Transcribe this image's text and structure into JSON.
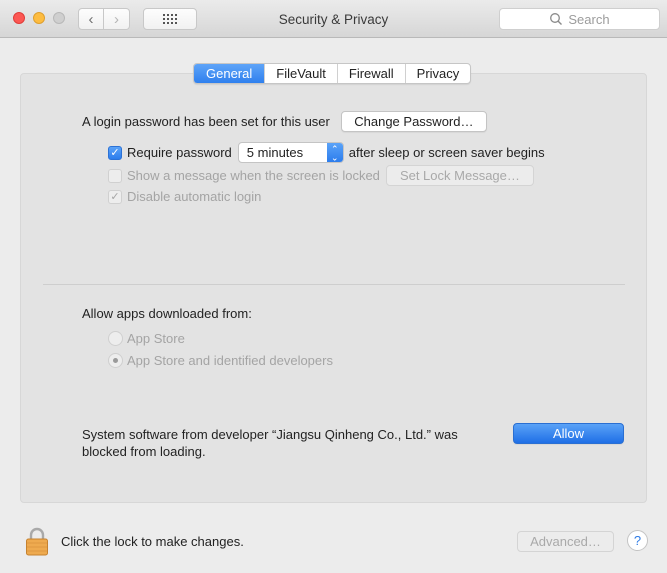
{
  "window": {
    "title": "Security & Privacy",
    "search_placeholder": "Search"
  },
  "toolbar": {
    "back_icon": "chevron-left",
    "forward_icon": "chevron-right",
    "show_all_icon": "grid-icon"
  },
  "tabs": [
    {
      "label": "General",
      "active": true
    },
    {
      "label": "FileVault",
      "active": false
    },
    {
      "label": "Firewall",
      "active": false
    },
    {
      "label": "Privacy",
      "active": false
    }
  ],
  "general": {
    "login_password_text": "A login password has been set for this user",
    "change_password_label": "Change Password…",
    "require_password": {
      "label": "Require password",
      "checked": true
    },
    "require_password_delay": "5 minutes",
    "require_password_suffix": "after sleep or screen saver begins",
    "show_message": {
      "label": "Show a message when the screen is locked",
      "checked": false,
      "enabled": false
    },
    "set_lock_message_label": "Set Lock Message…",
    "disable_auto_login": {
      "label": "Disable automatic login",
      "checked": true,
      "enabled": false
    }
  },
  "gatekeeper": {
    "heading": "Allow apps downloaded from:",
    "options": [
      {
        "label": "App Store",
        "selected": false
      },
      {
        "label": "App Store and identified developers",
        "selected": true
      }
    ]
  },
  "blocked": {
    "message": "System software from developer “Jiangsu Qinheng Co., Ltd.” was blocked from loading.",
    "allow_label": "Allow"
  },
  "footer": {
    "lock_text": "Click the lock to make changes.",
    "advanced_label": "Advanced…",
    "help_label": "?"
  },
  "colors": {
    "accent": "#2f80ee",
    "lock": "#e9a24a"
  }
}
